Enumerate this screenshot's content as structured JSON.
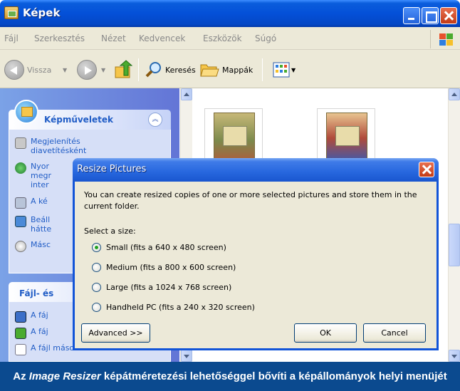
{
  "window": {
    "title": "Képek"
  },
  "menu": [
    "Fájl",
    "Szerkesztés",
    "Nézet",
    "Kedvencek",
    "Eszközök",
    "Súgó"
  ],
  "toolbar": {
    "back": "Vissza",
    "search": "Keresés",
    "folders": "Mappák"
  },
  "task_pane": {
    "picture_tasks": {
      "title": "Képműveletek",
      "items": [
        "Megjelenítés diavetítésként",
        "Nyor megr inter",
        "A ké",
        "Beáll hátte",
        "Másc"
      ]
    },
    "file_tasks": {
      "title": "Fájl- és",
      "items": [
        "A fáj",
        "A fáj",
        "A fájl másolása"
      ]
    }
  },
  "dialog": {
    "title": "Resize Pictures",
    "description": "You can create resized copies of one or more selected pictures and store them in the current folder.",
    "size_label": "Select a size:",
    "options": [
      {
        "label": "Small (fits a 640 x 480 screen)",
        "selected": true
      },
      {
        "label": "Medium (fits a 800 x 600 screen)",
        "selected": false
      },
      {
        "label": "Large (fits a 1024 x 768 screen)",
        "selected": false
      },
      {
        "label": "Handheld PC (fits a 240 x 320 screen)",
        "selected": false
      }
    ],
    "buttons": {
      "advanced": "Advanced >>",
      "ok": "OK",
      "cancel": "Cancel"
    }
  },
  "caption": {
    "prefix": "Az ",
    "app": "Image Resizer",
    "rest": " képátméretezési lehetőséggel bővíti a képállományok helyi menüjét"
  },
  "colors": {
    "caption_bg": "#0b4a8f",
    "title_blue": "#0450d8",
    "task_link": "#215dc6"
  }
}
